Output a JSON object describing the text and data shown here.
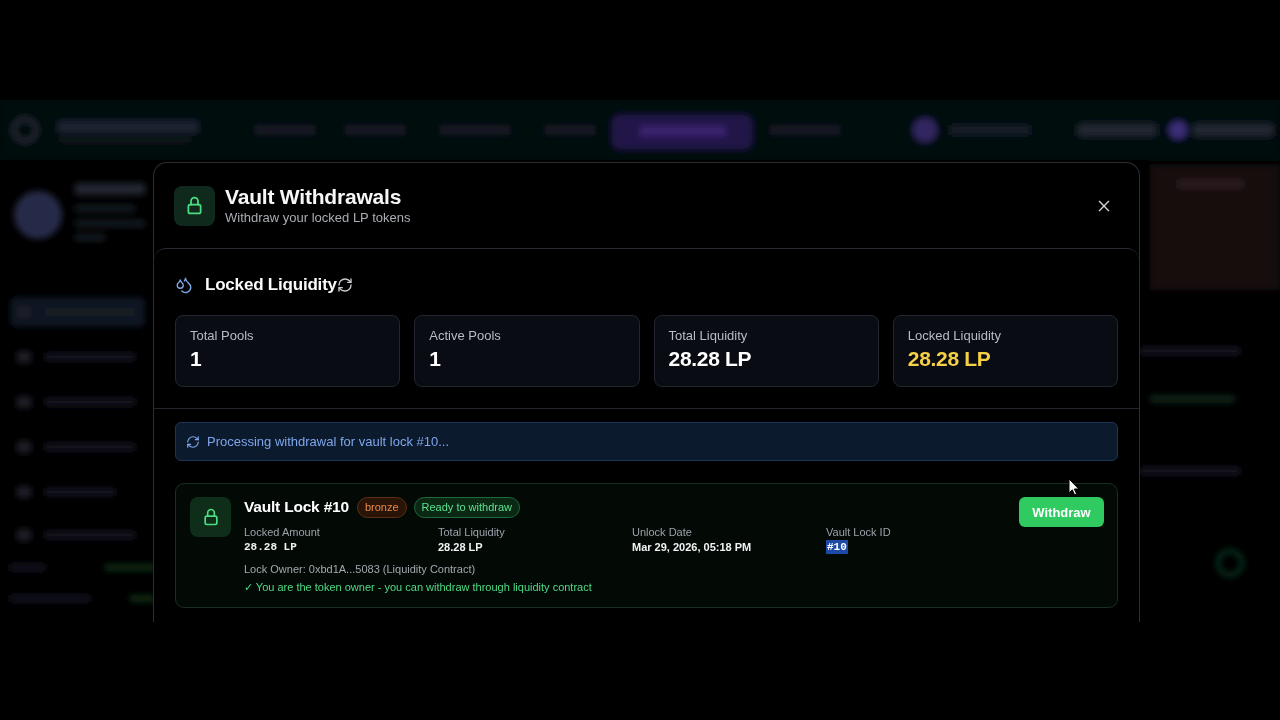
{
  "modal": {
    "title": "Vault Withdrawals",
    "subtitle": "Withdraw your locked LP tokens"
  },
  "panel": {
    "title": "Locked Liquidity"
  },
  "stats": [
    {
      "label": "Total Pools",
      "value": "1",
      "color": "#ffffff"
    },
    {
      "label": "Active Pools",
      "value": "1",
      "color": "#ffffff"
    },
    {
      "label": "Total Liquidity",
      "value": "28.28 LP",
      "color": "#ffffff"
    },
    {
      "label": "Locked Liquidity",
      "value": "28.28 LP",
      "color": "#f5cf45"
    }
  ],
  "notice": {
    "text": "Processing withdrawal for vault lock #10..."
  },
  "locks": [
    {
      "title": "Vault Lock #10",
      "badges": [
        {
          "text": "bronze",
          "kind": "tier"
        },
        {
          "text": "Ready to withdraw",
          "kind": "status"
        }
      ],
      "fields": [
        {
          "label": "Locked Amount",
          "value": "28.28 LP",
          "kind": "mono",
          "highlighted": false
        },
        {
          "label": "Total Liquidity",
          "value": "28.28 LP",
          "kind": "plain",
          "highlighted": false
        },
        {
          "label": "Unlock Date",
          "value": "Mar 29, 2026, 05:18 PM",
          "kind": "plain",
          "highlighted": false
        },
        {
          "label": "Vault Lock ID",
          "value": "#10",
          "kind": "mono",
          "highlighted": true
        }
      ],
      "owner": "Lock Owner: 0xbd1A...5083 (Liquidity Contract)",
      "note": "✓ You are the token owner - you can withdraw through liquidity contract",
      "button": "Withdraw"
    }
  ]
}
